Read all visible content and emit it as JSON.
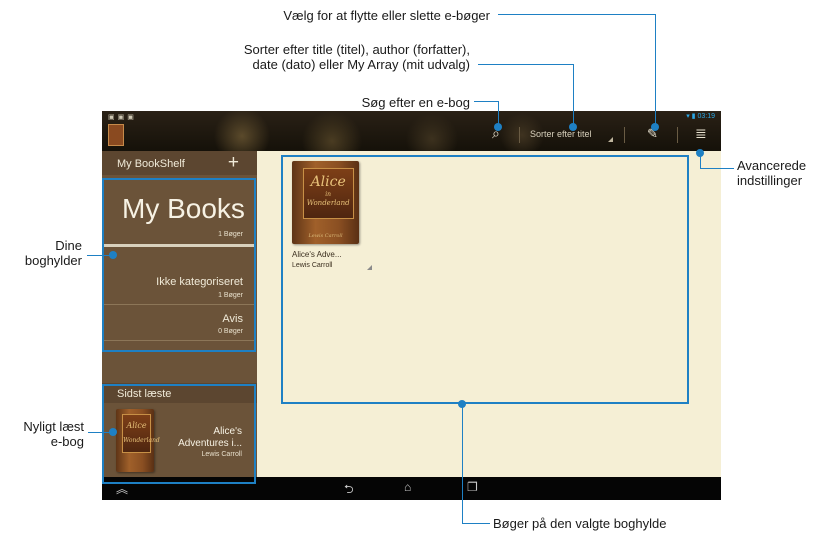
{
  "callouts": {
    "select": "Vælg for at flytte eller slette e-bøger",
    "sort_line1": "Sorter efter title (titel), author (forfatter),",
    "sort_line2": "date (dato) eller My Array (mit udvalg)",
    "search": "Søg efter en e-bog",
    "advanced_line1": "Avancerede",
    "advanced_line2": "indstillinger",
    "shelves_line1": "Dine",
    "shelves_line2": "boghylder",
    "recent_line1": "Nyligt læst",
    "recent_line2": "e-bog",
    "books_on_shelf": "Bøger på den valgte boghylde"
  },
  "status": {
    "time": "03:19"
  },
  "actionbar": {
    "sort_label": "Sorter efter titel"
  },
  "sidebar": {
    "title": "My BookShelf",
    "add_symbol": "+",
    "main_shelf": {
      "name": "My Books",
      "count": "1 Bøger"
    },
    "items": [
      {
        "name": "Ikke kategoriseret",
        "count": "1 Bøger"
      },
      {
        "name": "Avis",
        "count": "0 Bøger"
      }
    ]
  },
  "recent": {
    "title": "Sidst læste",
    "book_name_line1": "Alice's",
    "book_name_line2": "Adventures i...",
    "author": "Lewis Carroll"
  },
  "books": [
    {
      "title": "Alice's Adve...",
      "author": "Lewis Carroll",
      "cover_title": "Alice",
      "cover_sub": "in",
      "cover_title2": "Wonderland",
      "cover_author": "Lewis Carroll"
    }
  ],
  "colors": {
    "accent": "#1e80c4",
    "shelf_bg": "#6b5339",
    "content_bg": "#f5efd5"
  }
}
